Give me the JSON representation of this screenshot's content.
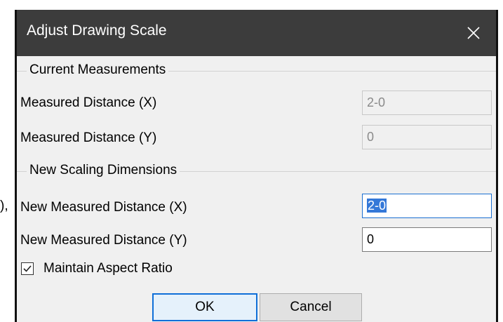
{
  "background": {
    "fragment": "),"
  },
  "dialog": {
    "title": "Adjust Drawing Scale",
    "close_icon": "×",
    "current": {
      "label": "Current Measurements",
      "rows": [
        {
          "label": "Measured Distance (X)",
          "value": "2-0"
        },
        {
          "label": "Measured Distance (Y)",
          "value": "0"
        }
      ]
    },
    "new": {
      "label": "New Scaling Dimensions",
      "rows": [
        {
          "label": "New Measured Distance (X)",
          "value": "2-0"
        },
        {
          "label": "New Measured Distance (Y)",
          "value": "0"
        }
      ]
    },
    "maintain_aspect": {
      "label": "Maintain Aspect Ratio",
      "checked": true
    },
    "buttons": {
      "ok": "OK",
      "cancel": "Cancel"
    }
  }
}
